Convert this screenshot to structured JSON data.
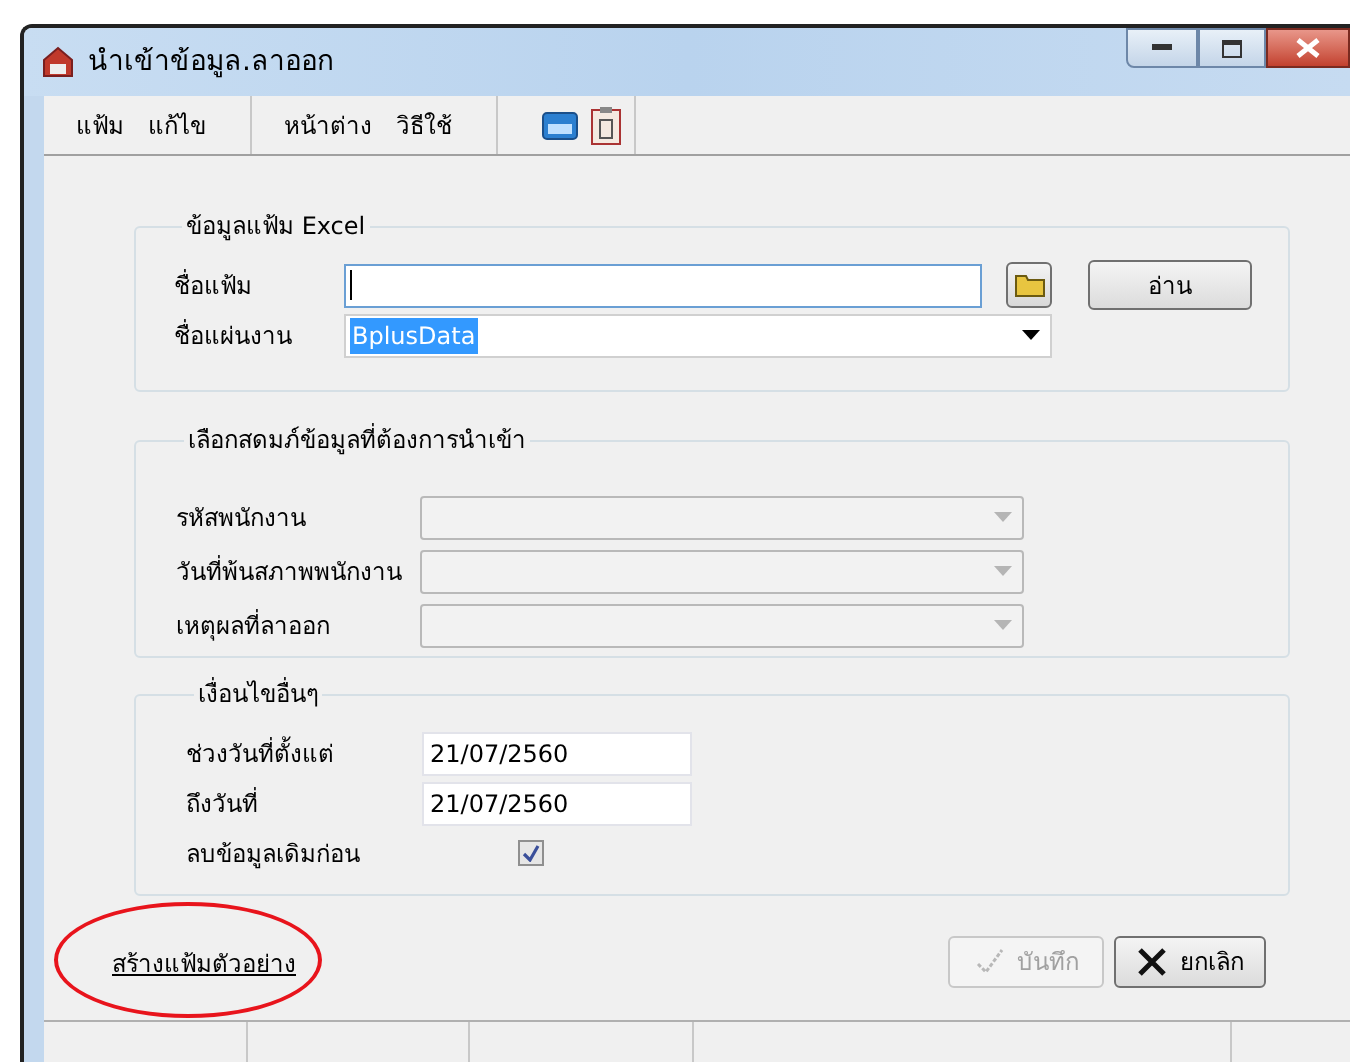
{
  "window": {
    "title": "นำเข้าข้อมูล.ลาออก"
  },
  "menu": [
    {
      "items": [
        "แฟ้ม",
        "แก้ไข"
      ]
    },
    {
      "items": [
        "หน้าต่าง",
        "วิธีใช้"
      ]
    }
  ],
  "groups": [
    {
      "title": "ข้อมูลแฟ้ม Excel",
      "fields": [
        {
          "kind": "file",
          "label": "ชื่อแฟ้ม",
          "focused": true,
          "button": "อ่าน"
        },
        {
          "kind": "combo",
          "label": "ชื่อแผ่นงาน",
          "value": "BplusData",
          "disabled": false,
          "highlighted": true
        }
      ]
    },
    {
      "title": "เลือกสดมภ์ข้อมูลที่ต้องการนำเข้า",
      "fields": [
        {
          "kind": "combo",
          "label": "รหัสพนักงาน",
          "disabled": true
        },
        {
          "kind": "combo",
          "label": "วันที่พ้นสภาพพนักงาน",
          "disabled": true
        },
        {
          "kind": "combo",
          "label": "เหตุผลที่ลาออก",
          "disabled": true
        }
      ]
    },
    {
      "title": "เงื่อนไขอื่นๆ",
      "fields": [
        {
          "kind": "date",
          "label": "ช่วงวันที่ตั้งแต่",
          "value": "21/07/2560"
        },
        {
          "kind": "date",
          "label": "ถึงวันที่",
          "value": "21/07/2560"
        },
        {
          "kind": "checkbox",
          "label": "ลบข้อมูลเดิมก่อน",
          "checked": true
        }
      ]
    }
  ],
  "link": {
    "label": "สร้างแฟ้มตัวอย่าง",
    "circled": true
  },
  "buttons": [
    {
      "kind": "save",
      "label": "บันทึก",
      "disabled": true
    },
    {
      "kind": "cancel",
      "label": "ยกเลิก",
      "disabled": false
    }
  ]
}
